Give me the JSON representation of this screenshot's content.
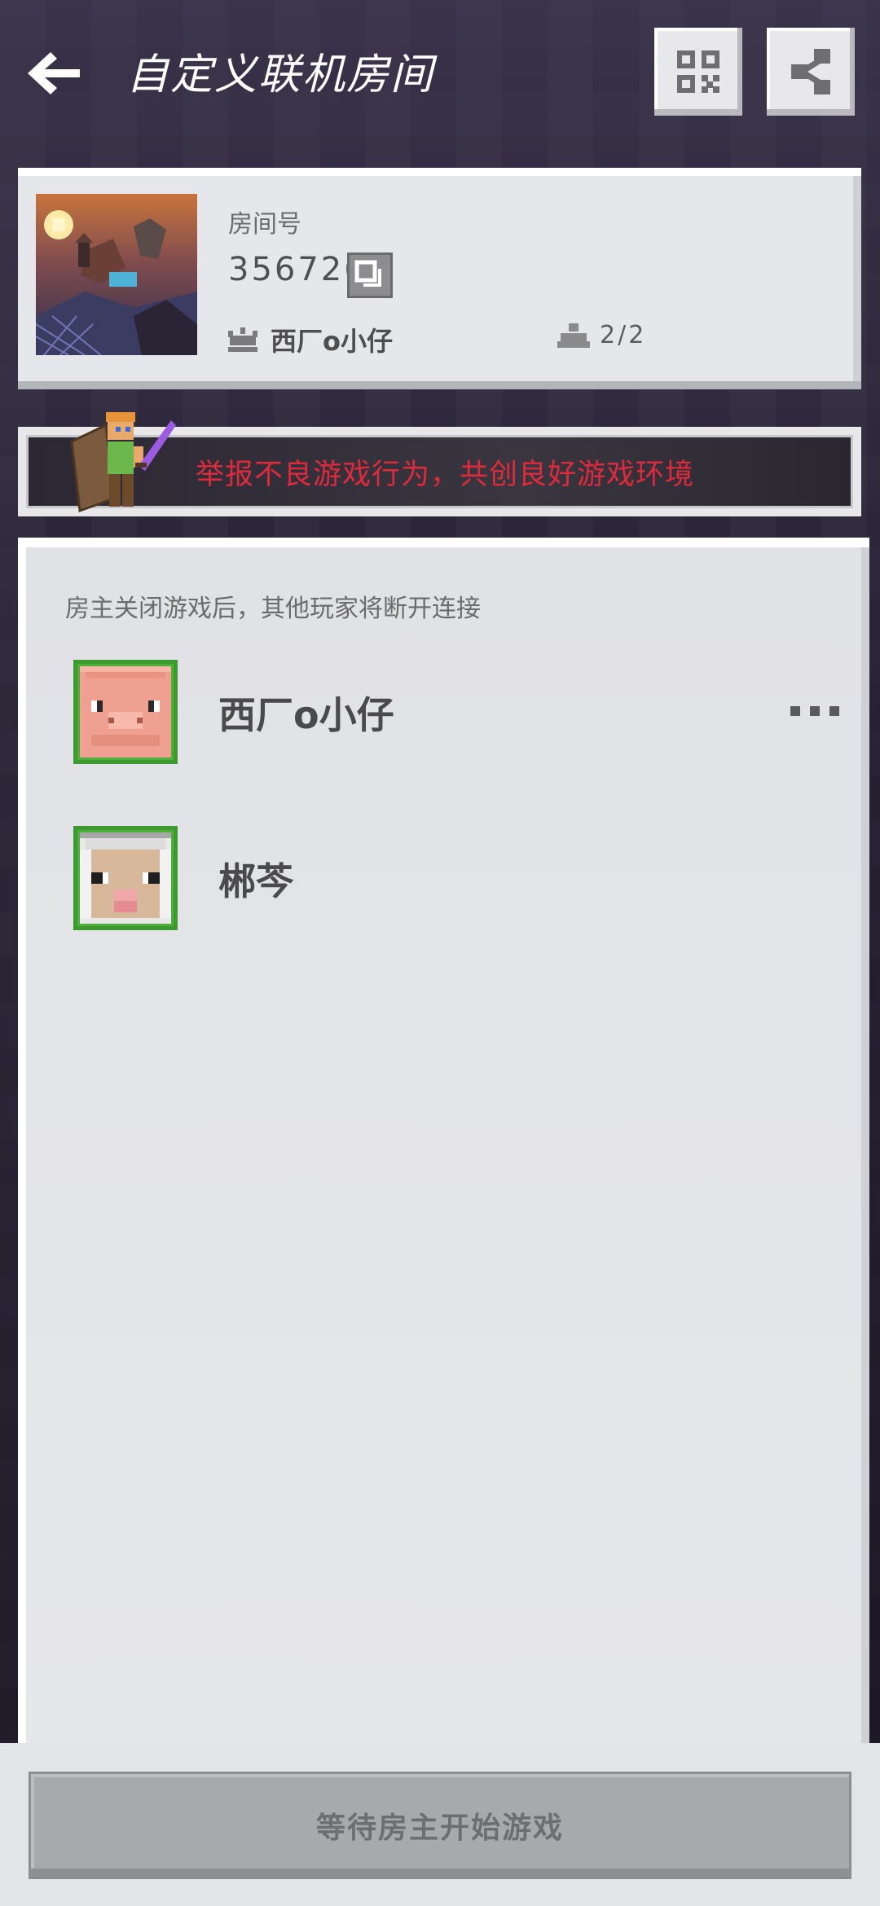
{
  "header": {
    "title": "自定义联机房间",
    "back_icon": "arrow-left-icon",
    "qr_icon": "qr-code-icon",
    "share_icon": "share-icon"
  },
  "room": {
    "id_label": "房间号",
    "id": "356726",
    "host_name": "西厂o小仔",
    "player_count": "2/2"
  },
  "report_banner": {
    "text": "举报不良游戏行为，共创良好游戏环境",
    "color": "#e02a3c"
  },
  "players": {
    "notice": "房主关闭游戏后，其他玩家将断开连接",
    "list": [
      {
        "name": "西厂o小仔",
        "avatar": "pig-head-avatar"
      },
      {
        "name": "郴芩",
        "avatar": "sheep-head-avatar"
      }
    ]
  },
  "bottom": {
    "start_label": "等待房主开始游戏"
  }
}
